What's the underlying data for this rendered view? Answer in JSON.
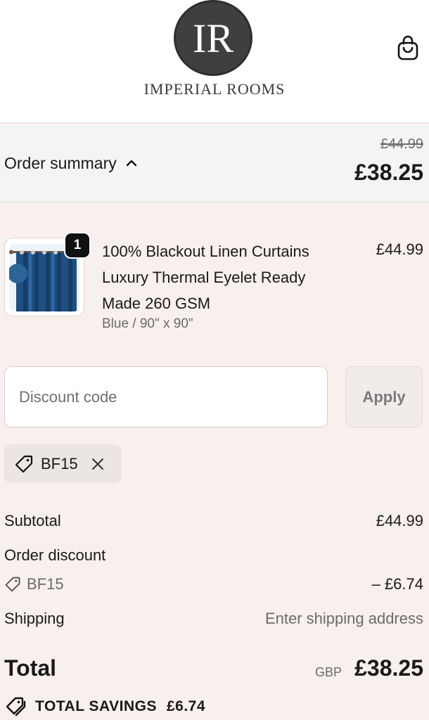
{
  "header": {
    "logo_monogram": "IR",
    "logo_text": "IMPERIAL ROOMS",
    "cart_icon": "shopping-bag-icon"
  },
  "summary_bar": {
    "toggle_label": "Order summary",
    "toggle_icon": "chevron-up-icon",
    "original_price": "£44.99",
    "total": "£38.25"
  },
  "product": {
    "quantity": "1",
    "name": "100% Blackout Linen Curtains Luxury Thermal Eyelet Ready Made 260 GSM",
    "variant": "Blue / 90\" x 90\"",
    "price": "£44.99"
  },
  "discount": {
    "placeholder": "Discount code",
    "apply_label": "Apply",
    "applied_code": "BF15",
    "tag_icon": "tag-icon",
    "remove_icon": "close-icon"
  },
  "totals": {
    "subtotal_label": "Subtotal",
    "subtotal_value": "£44.99",
    "order_discount_label": "Order discount",
    "discount_code": "BF15",
    "discount_value": "– £6.74",
    "shipping_label": "Shipping",
    "shipping_value": "Enter shipping address",
    "total_label": "Total",
    "currency": "GBP",
    "total_value": "£38.25",
    "savings_label": "TOTAL SAVINGS",
    "savings_value": "£6.74"
  },
  "colors": {
    "page_bg": "#f7f0ed",
    "bar_bg": "#f4f4f4",
    "curtain_blue": "#1f4f82"
  }
}
